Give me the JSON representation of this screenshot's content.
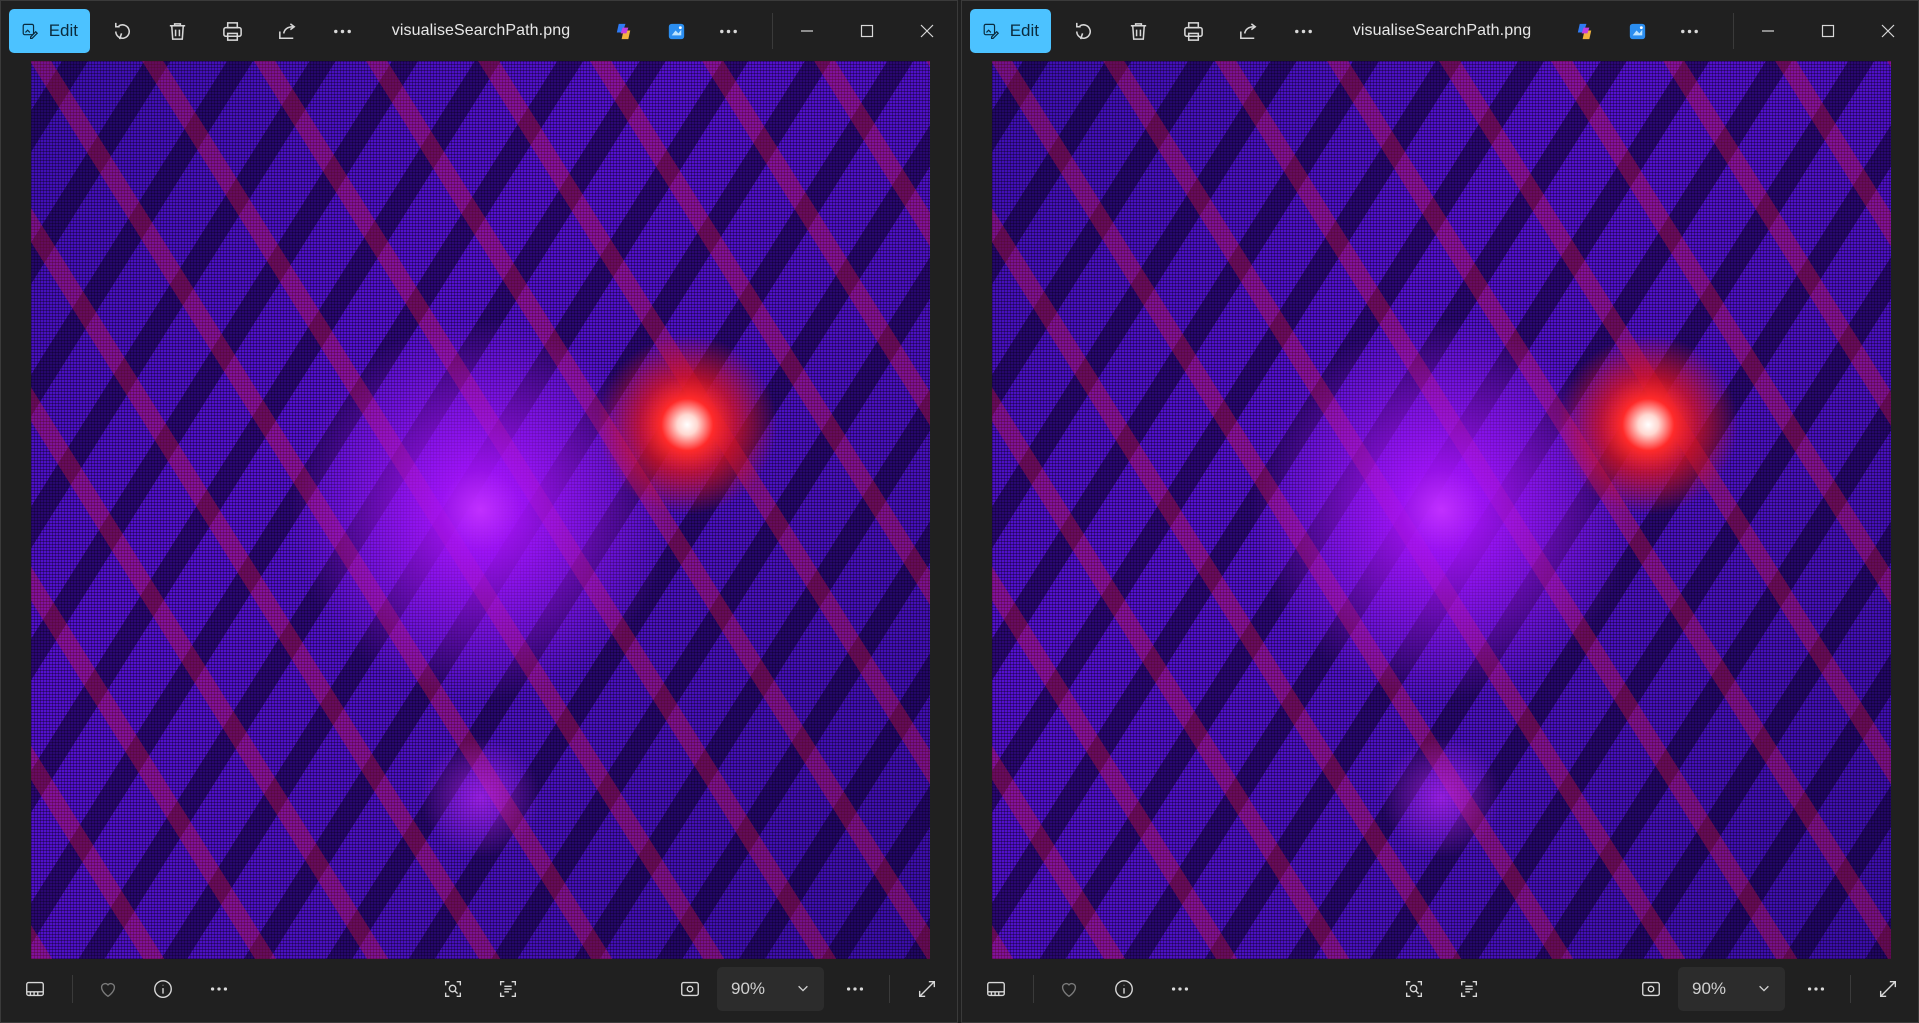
{
  "windows": [
    {
      "edit_label": "Edit",
      "title": "visualiseSearchPath.png",
      "zoom_value": "90%",
      "icons": {
        "rotate": "rotate-icon",
        "delete": "trash-icon",
        "print": "print-icon",
        "share": "share-icon",
        "more": "more-icon",
        "copilot": "copilot-icon",
        "designer": "designer-icon",
        "filmstrip": "filmstrip-icon",
        "favorite": "heart-icon",
        "info": "info-icon",
        "visual_search": "visual-search-icon",
        "scan_text": "scan-text-icon",
        "actual_size": "actual-size-icon",
        "fullscreen": "fullscreen-icon"
      }
    },
    {
      "edit_label": "Edit",
      "title": "visualiseSearchPath.png",
      "zoom_value": "90%"
    }
  ],
  "colors": {
    "accent": "#4cc2ff",
    "background": "#202020"
  }
}
